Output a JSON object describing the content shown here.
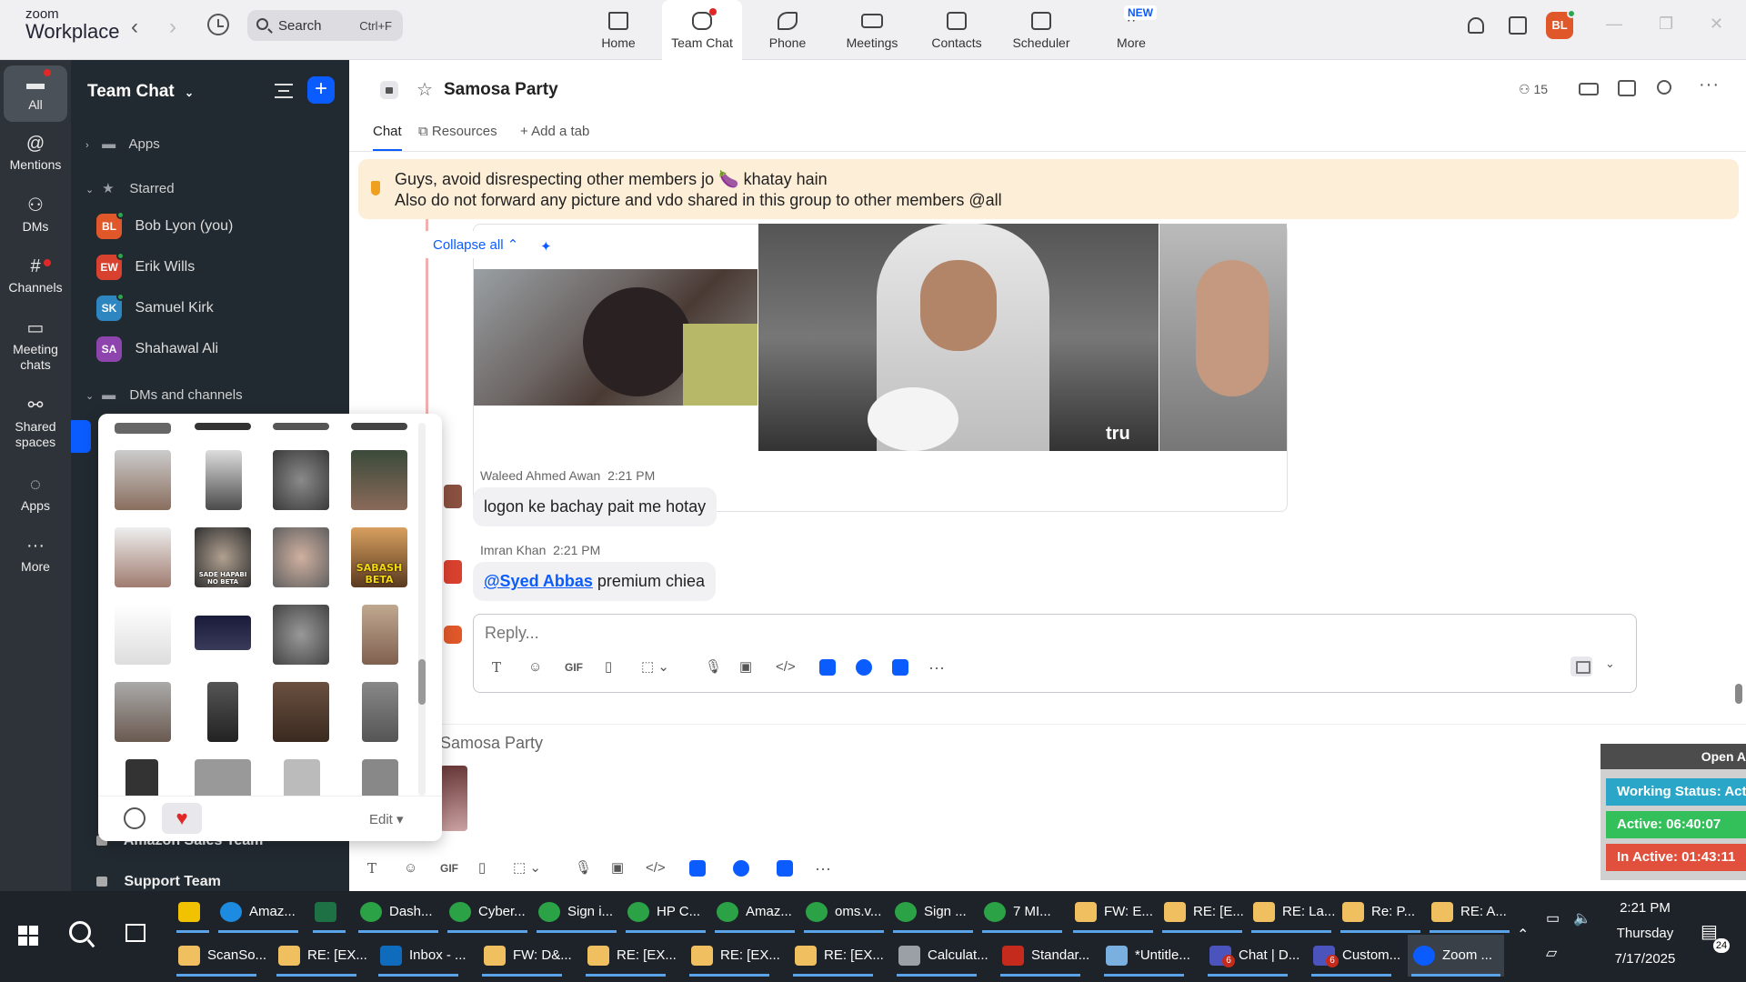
{
  "app": {
    "logo_small": "zoom",
    "logo_big": "Workplace",
    "search_placeholder": "Search",
    "search_shortcut": "Ctrl+F",
    "nav": [
      {
        "label": "Home"
      },
      {
        "label": "Team Chat"
      },
      {
        "label": "Phone"
      },
      {
        "label": "Meetings"
      },
      {
        "label": "Contacts"
      },
      {
        "label": "Scheduler"
      },
      {
        "label": "More"
      }
    ],
    "new_badge": "NEW",
    "user_initials": "BL"
  },
  "rail": [
    {
      "label": "All",
      "icon": "chat-icon"
    },
    {
      "label": "Mentions",
      "icon": "at-icon"
    },
    {
      "label": "DMs",
      "icon": "people-icon"
    },
    {
      "label": "Channels",
      "icon": "hash-icon"
    },
    {
      "label": "Meeting chats",
      "icon": "calendar-icon"
    },
    {
      "label": "Shared spaces",
      "icon": "spaces-icon"
    },
    {
      "label": "Apps",
      "icon": "apps-icon"
    },
    {
      "label": "More",
      "icon": "more-icon"
    }
  ],
  "sidebar": {
    "title": "Team Chat",
    "sections": {
      "apps": "Apps",
      "starred": "Starred",
      "dms": "DMs and channels"
    },
    "starred": [
      {
        "initials": "BL",
        "name": "Bob Lyon (you)",
        "color": "#e0582a"
      },
      {
        "initials": "EW",
        "name": "Erik Wills",
        "color": "#d9412f"
      },
      {
        "initials": "SK",
        "name": "Samuel Kirk",
        "color": "#2e86c1"
      },
      {
        "initials": "SA",
        "name": "Shahawal Ali",
        "color": "#8e44ad"
      }
    ],
    "channels": [
      "Amazon Sales Team",
      "Support Team"
    ]
  },
  "picker": {
    "captions": [
      "SADE HAPABI NO BETA",
      "SABASH BETA"
    ],
    "edit_label": "Edit"
  },
  "chat": {
    "title": "Samosa Party",
    "member_count": "15",
    "tabs": [
      "Chat",
      "Resources",
      "Add a tab"
    ],
    "pinned_line1": "Guys, avoid disrespecting other members jo 🍆 khatay hain",
    "pinned_line2": "Also do not forward any picture and vdo shared in this group to other members @all",
    "collapse_label": "Collapse all ⌃",
    "watermark": "tru",
    "messages": [
      {
        "sender": "Waleed Ahmed Awan",
        "time": "2:21 PM",
        "text": "logon ke bachay pait me hotay"
      },
      {
        "sender": "Imran Khan",
        "time": "2:21 PM",
        "mention": "@Syed Abbas",
        "text": " premium chiea"
      }
    ],
    "composer_placeholder": "Reply...",
    "background_title": "Samosa Party"
  },
  "status_widget": {
    "header": "Open A",
    "working": "Working Status: Acti",
    "active": "Active: 06:40:07",
    "inactive": "In Active: 01:43:11",
    "colors": {
      "working": "#2aa7c8",
      "active": "#33c05a",
      "inactive": "#e0503c"
    }
  },
  "taskbar": {
    "row1": [
      "",
      "Amaz...",
      "",
      "Dash...",
      "Cyber...",
      "Sign i...",
      "HP C...",
      "Amaz...",
      "oms.v...",
      "Sign ...",
      "7 MI...",
      "FW: E...",
      "RE: [E...",
      "RE: La...",
      "Re: P...",
      "RE: A..."
    ],
    "row2": [
      "ScanSo...",
      "RE: [EX...",
      "Inbox - ...",
      "FW: D&...",
      "RE: [EX...",
      "RE: [EX...",
      "RE: [EX...",
      "Calculat...",
      "Standar...",
      "*Untitle...",
      "Chat | D...",
      "Custom...",
      "Zoom ..."
    ],
    "badges": {
      "chat": "6",
      "custom": "6",
      "notif": "24"
    },
    "time": "2:21 PM",
    "day": "Thursday",
    "date": "7/17/2025"
  }
}
